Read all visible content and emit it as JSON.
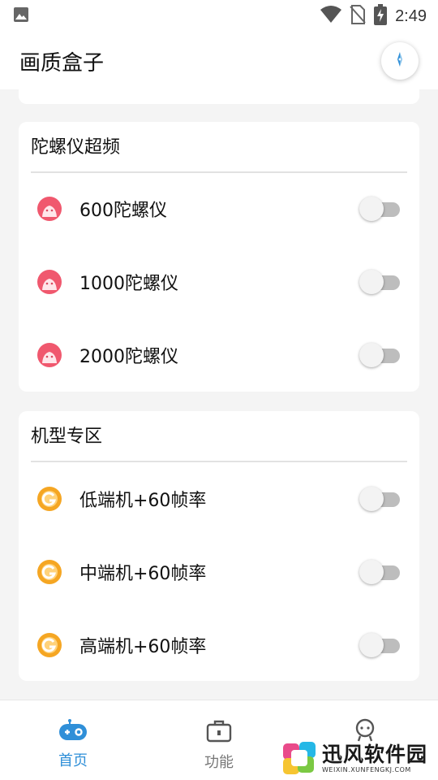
{
  "status_bar": {
    "time": "2:49",
    "icons": [
      "image-icon",
      "wifi-icon",
      "no-sim-icon",
      "battery-charging-icon"
    ]
  },
  "app_bar": {
    "title": "画质盒子",
    "action_icon": "compass-icon"
  },
  "sections": [
    {
      "title": "陀螺仪超频",
      "icon": "game-avatar-icon",
      "items": [
        {
          "label": "600陀螺仪",
          "enabled": false
        },
        {
          "label": "1000陀螺仪",
          "enabled": false
        },
        {
          "label": "2000陀螺仪",
          "enabled": false
        }
      ]
    },
    {
      "title": "机型专区",
      "icon": "orange-g-icon",
      "items": [
        {
          "label": "低端机+60帧率",
          "enabled": false
        },
        {
          "label": "中端机+60帧率",
          "enabled": false
        },
        {
          "label": "高端机+60帧率",
          "enabled": false
        }
      ]
    }
  ],
  "bottom_nav": {
    "items": [
      {
        "label": "首页",
        "icon": "gamepad-icon",
        "active": true
      },
      {
        "label": "功能",
        "icon": "toolbox-icon",
        "active": false
      },
      {
        "label": "",
        "icon": "robot-icon",
        "active": false
      }
    ]
  },
  "watermark": {
    "name": "迅风软件园",
    "url": "WEIXIN.XUNFENGKJ.COM"
  },
  "colors": {
    "accent": "#2f8fd8",
    "toggle_track": "#bdbdbd",
    "background": "#f4f4f4"
  }
}
